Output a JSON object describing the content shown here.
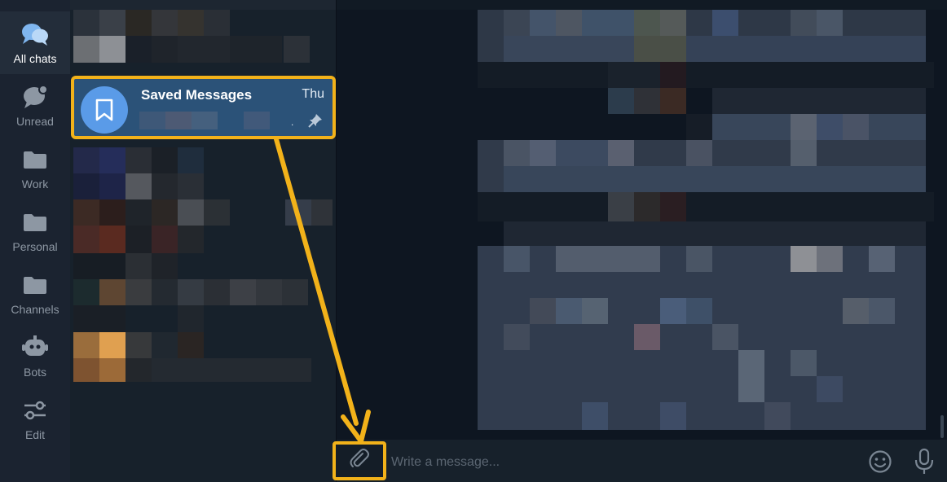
{
  "folders": [
    {
      "label": "All chats",
      "icon": "chats-icon",
      "active": true
    },
    {
      "label": "Unread",
      "icon": "unread-chat-icon",
      "active": false
    },
    {
      "label": "Work",
      "icon": "folder-icon",
      "active": false
    },
    {
      "label": "Personal",
      "icon": "folder-icon",
      "active": false
    },
    {
      "label": "Channels",
      "icon": "folder-icon",
      "active": false
    },
    {
      "label": "Bots",
      "icon": "bot-icon",
      "active": false
    },
    {
      "label": "Edit",
      "icon": "sliders-icon",
      "active": false
    }
  ],
  "saved_chat": {
    "name": "Saved Messages",
    "date": "Thu",
    "icon": "bookmark-icon",
    "pinned": true,
    "preview": "."
  },
  "composer": {
    "placeholder": "Write a message..."
  },
  "colors": {
    "accent_highlight": "#f2b21a",
    "selected_chat": "#2b5278",
    "avatar": "#5a9be8"
  }
}
